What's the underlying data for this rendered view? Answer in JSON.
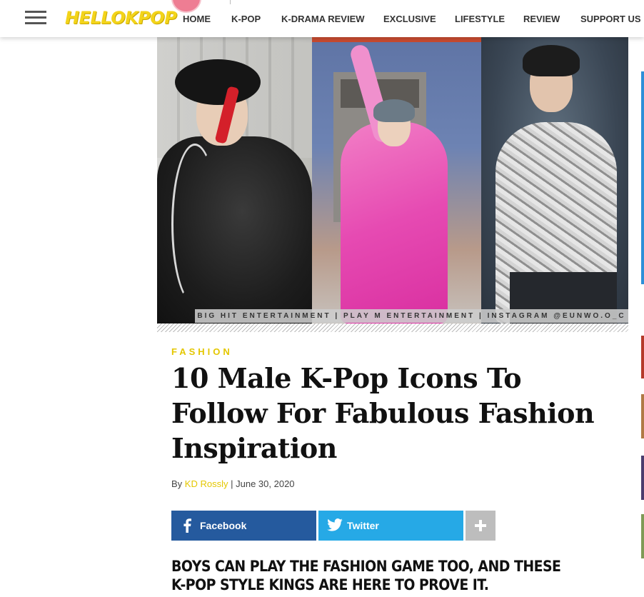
{
  "header": {
    "logo_text": "HELLOKPOP",
    "nav": [
      {
        "label": "HOME"
      },
      {
        "label": "K-POP"
      },
      {
        "label": "K-DRAMA REVIEW"
      },
      {
        "label": "EXCLUSIVE"
      },
      {
        "label": "LIFESTYLE"
      },
      {
        "label": "REVIEW"
      },
      {
        "label": "SUPPORT US"
      }
    ],
    "menu_icon": "hamburger-menu-icon"
  },
  "hero": {
    "credit": "BIG HIT ENTERTAINMENT | PLAY M ENTERTAINMENT | INSTAGRAM @EUNWO.O_C"
  },
  "article": {
    "category": "FASHION",
    "title": "10 Male K-Pop Icons To Follow For Fabulous Fashion Inspiration",
    "byline_prefix": "By",
    "author": "KD Rossly",
    "byline_sep": "|",
    "date": "June 30, 2020",
    "lead": "BOYS CAN PLAY THE FASHION GAME TOO, AND THESE K-POP STYLE KINGS ARE HERE TO PROVE IT."
  },
  "share": {
    "facebook_label": "Facebook",
    "twitter_label": "Twitter",
    "icons": {
      "facebook": "facebook-icon",
      "twitter": "twitter-icon",
      "more": "plus-icon"
    }
  },
  "colors": {
    "accent_yellow": "#e4c700",
    "facebook_blue": "#255a9e",
    "twitter_blue": "#26a9e6",
    "more_gray": "#bdbdbd"
  }
}
